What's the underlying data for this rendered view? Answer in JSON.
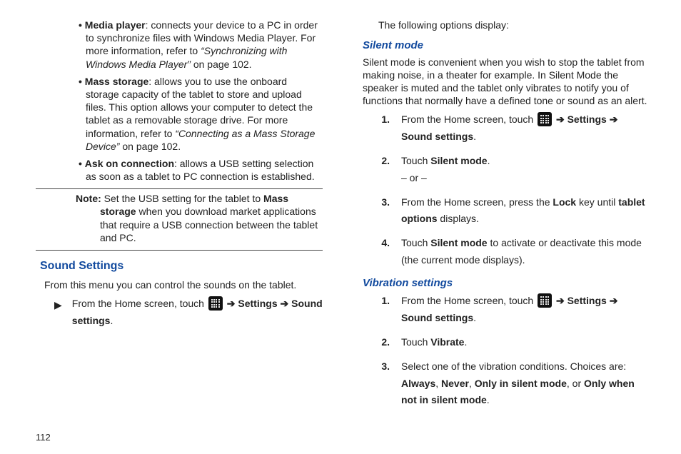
{
  "left": {
    "bullets": [
      {
        "lead": "Media player",
        "text_a": ": connects your device to a PC in order to synchronize files with Windows Media Player. For more information, refer to ",
        "ref": "“Synchronizing with Windows Media Player”",
        "text_b": "  on page 102."
      },
      {
        "lead": "Mass storage",
        "text_a": ": allows you to use the onboard storage capacity of the tablet to store and upload files. This option allows your computer to detect the tablet as a removable storage drive. For more information, refer to ",
        "ref": "“Connecting as a Mass Storage Device”",
        "text_b": "  on page 102."
      },
      {
        "lead": "Ask on connection",
        "text_a": ": allows a USB setting selection as soon as a tablet to PC connection is established.",
        "ref": "",
        "text_b": ""
      }
    ],
    "note_lead": "Note:",
    "note_a": " Set the USB setting for the tablet to ",
    "note_b": "Mass storage",
    "note_c": " when you download market applications that require a USB connection between the tablet and PC.",
    "h1": "Sound Settings",
    "intro": "From this menu you can control the sounds on the tablet.",
    "step_a": "From the Home screen, touch ",
    "step_b": " ➔ ",
    "step_c": "Settings",
    "step_d": " ➔ ",
    "step_e": "Sound settings",
    "step_f": "."
  },
  "right": {
    "intro": "The following options display:",
    "silent_h": "Silent mode",
    "silent_body": "Silent mode is convenient when you wish to stop the tablet from making noise, in a theater for example. In Silent Mode the speaker is muted and the tablet only vibrates to notify you of functions that normally have a defined tone or sound as an alert.",
    "s1_a": "From the Home screen, touch ",
    "s1_b": " ➔ ",
    "s1_c": "Settings",
    "s1_d": " ➔ ",
    "s1_e": "Sound settings",
    "s1_f": ".",
    "s2_a": "Touch ",
    "s2_b": "Silent mode",
    "s2_c": ".",
    "s2_or": "– or –",
    "s3_a": "From the Home screen, press the ",
    "s3_b": "Lock",
    "s3_c": " key until ",
    "s3_d": "tablet options",
    "s3_e": " displays.",
    "s4_a": "Touch ",
    "s4_b": "Silent mode",
    "s4_c": " to activate or deactivate this mode (the current mode displays).",
    "vib_h": "Vibration settings",
    "v1_a": "From the Home screen, touch ",
    "v1_b": " ➔ ",
    "v1_c": "Settings",
    "v1_d": " ➔ ",
    "v1_e": "Sound settings",
    "v1_f": ".",
    "v2_a": "Touch ",
    "v2_b": "Vibrate",
    "v2_c": ".",
    "v3_a": "Select one of the vibration conditions. Choices are: ",
    "v3_b": "Always",
    "v3_c": ", ",
    "v3_d": "Never",
    "v3_e": ", ",
    "v3_f": "Only in silent mode",
    "v3_g": ", or ",
    "v3_h": "Only when not in silent mode",
    "v3_i": "."
  },
  "pagenum": "112",
  "nums": {
    "n1": "1.",
    "n2": "2.",
    "n3": "3.",
    "n4": "4."
  },
  "bullet": "•",
  "tri": "▶"
}
